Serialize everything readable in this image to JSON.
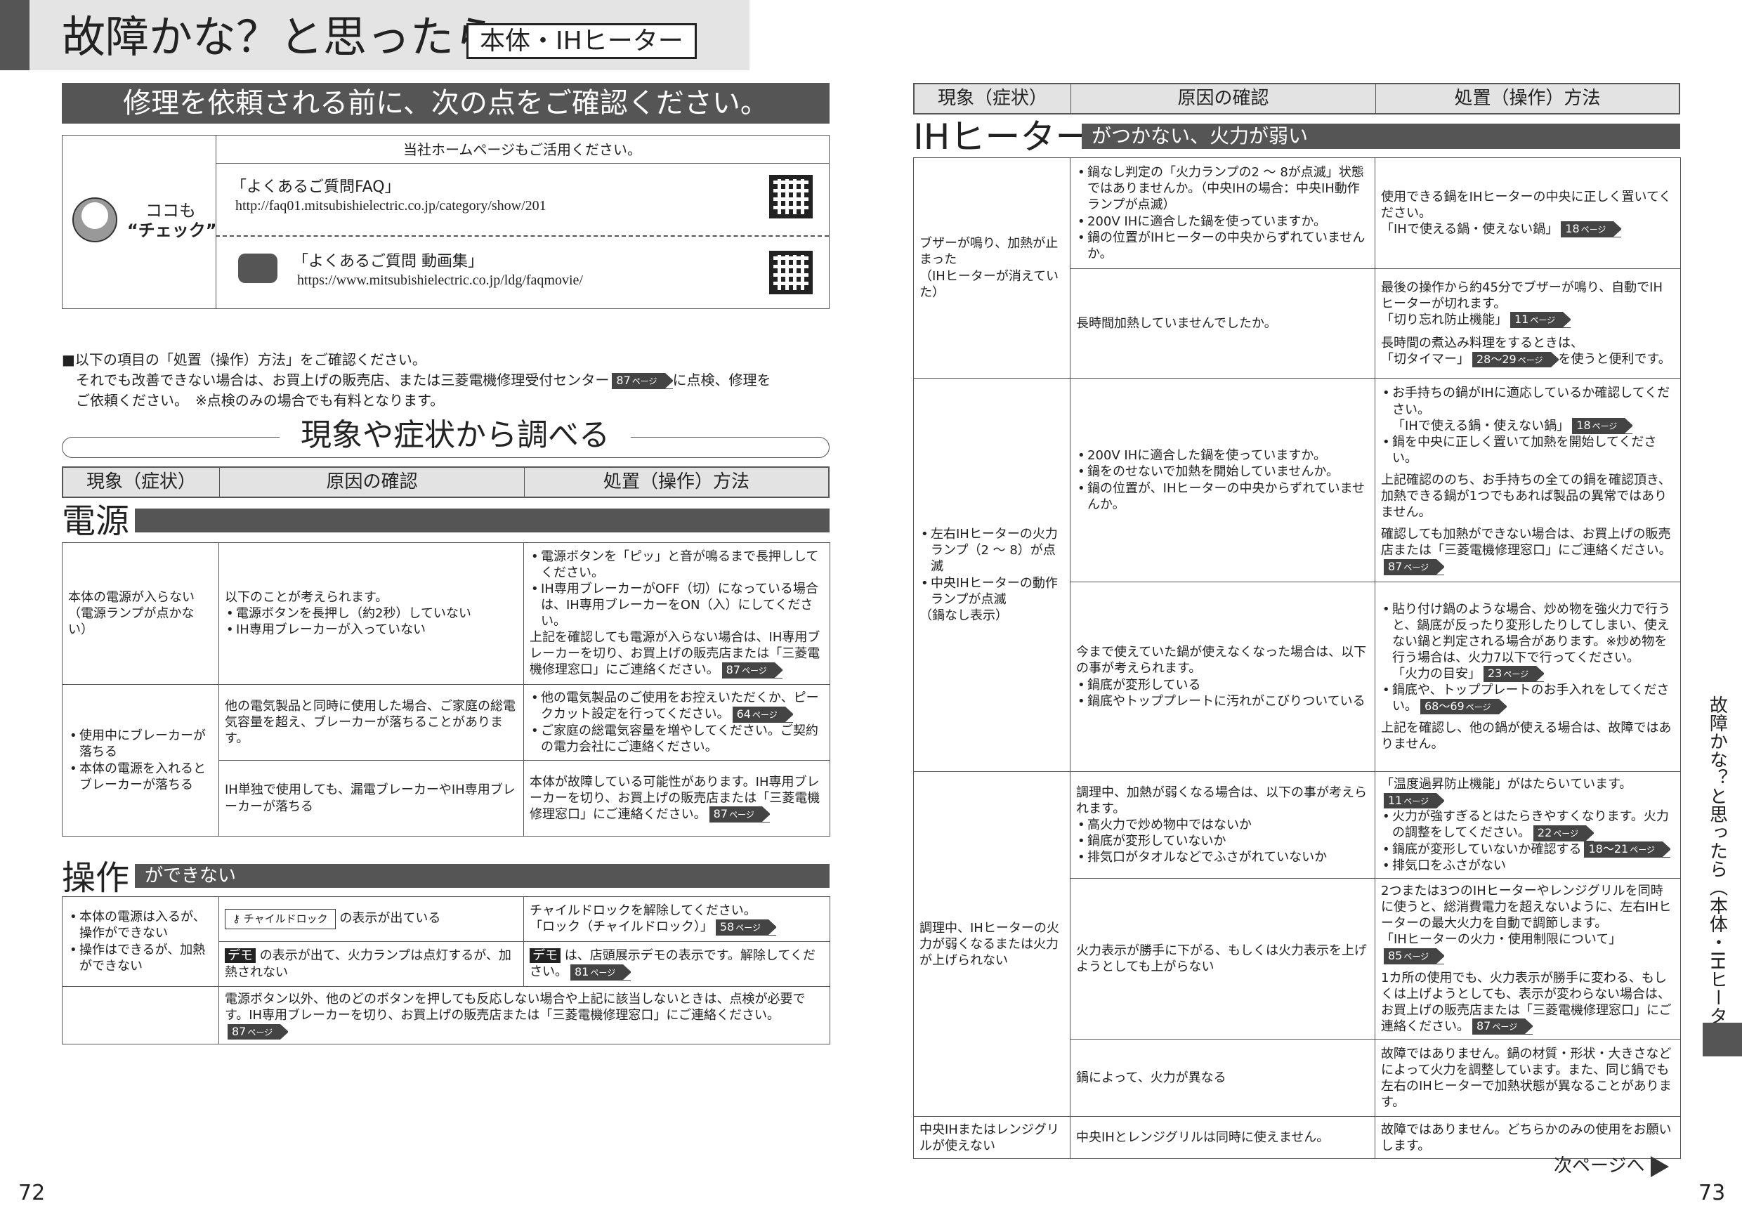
{
  "header": {
    "title": "故障かな？と思ったら",
    "tag": "本体・IHヒーター"
  },
  "left": {
    "banner": "修理を依頼される前に、次の点をご確認ください。",
    "homepage": {
      "top": "当社ホームページもご活用ください。",
      "check_a": "ココも",
      "check_b": "“チェック”",
      "faq_title": "「よくあるご質問FAQ」",
      "faq_url": "http://faq01.mitsubishielectric.co.jp/category/show/201",
      "movie_title": "「よくあるご質問 動画集」",
      "movie_url": "https://www.mitsubishielectric.co.jp/ldg/faqmovie/"
    },
    "note1": "■以下の項目の「処置（操作）方法」をご確認ください。",
    "note2a": "それでも改善できない場合は、お買上げの販売店、または三菱電機修理受付センター",
    "note2b": "に点検、修理を",
    "note3": "ご依頼ください。　※点検のみの場合でも有料となります。",
    "ref87": "87",
    "investigate": "現象や症状から調べる",
    "cols": [
      "現象（症状）",
      "原因の確認",
      "処置（操作）方法"
    ],
    "power": {
      "title": "電源",
      "r1": {
        "sym": "本体の電源が入らない\n（電源ランプが点かない）",
        "cause_intro": "以下のことが考えられます。",
        "causes": [
          "電源ボタンを長押し（約2秒）していない",
          "IH専用ブレーカーが入っていない"
        ],
        "acts": [
          "電源ボタンを「ピッ」と音が鳴るまで長押ししてください。",
          "IH専用ブレーカーがOFF（切）になっている場合は、IH専用ブレーカーをON（入）にしてください。"
        ],
        "act_tail": "上記を確認しても電源が入らない場合は、IH専用ブレーカーを切り、お買上げの販売店または「三菱電機修理窓口」にご連絡ください。",
        "ref": "87"
      },
      "r2": {
        "syms": [
          "使用中にブレーカーが落ちる",
          "本体の電源を入れるとブレーカーが落ちる"
        ],
        "c1": "他の電気製品と同時に使用した場合、ご家庭の総電気容量を超え、ブレーカーが落ちることがあります。",
        "a1": [
          "他の電気製品のご使用をお控えいただくか、ピークカット設定を行ってください。",
          "ご家庭の総電気容量を増やしてください。ご契約の電力会社にご連絡ください。"
        ],
        "a1ref": "64",
        "c2": "IH単独で使用しても、漏電ブレーカーやIH専用ブレーカーが落ちる",
        "a2": "本体が故障している可能性があります。IH専用ブレーカーを切り、お買上げの販売店または「三菱電機修理窓口」にご連絡ください。",
        "a2ref": "87"
      }
    },
    "op": {
      "title": "操作",
      "sub": "ができない",
      "syms": [
        "本体の電源は入るが、操作ができない",
        "操作はできるが、加熱ができない"
      ],
      "c1_label": "チャイルドロック",
      "c1": "の表示が出ている",
      "a1": "チャイルドロックを解除してください。",
      "a1b": "「ロック（チャイルドロック）」",
      "a1ref": "58",
      "c2_tag": "デモ",
      "c2": "の表示が出て、火力ランプは点灯するが、加熱されない",
      "a2": "は、店頭展示デモの表示です。解除してください。",
      "a2ref": "81",
      "wide": "電源ボタン以外、他のどのボタンを押しても反応しない場合や上記に該当しないときは、点検が必要です。IH専用ブレーカーを切り、お買上げの販売店または「三菱電機修理窓口」にご連絡ください。",
      "wide_ref": "87"
    },
    "page_no": "72"
  },
  "right": {
    "cols": [
      "現象（症状）",
      "原因の確認",
      "処置（操作）方法"
    ],
    "sec_title": "IHヒーター",
    "sec_sub": "がつかない、火力が弱い",
    "r1": {
      "sym": "ブザーが鳴り、加熱が止まった\n（IHヒーターが消えていた）",
      "c1": [
        "鍋なし判定の「火力ランプの2 ～ 8が点滅」状態ではありませんか。（中央IHの場合：中央IH動作ランプが点滅）",
        "200V IHに適合した鍋を使っていますか。",
        "鍋の位置がIHヒーターの中央からずれていませんか。"
      ],
      "a1": "使用できる鍋をIHヒーターの中央に正しく置いてください。",
      "a1b": "「IHで使える鍋・使えない鍋」",
      "a1ref": "18",
      "c2": "長時間加熱していませんでしたか。",
      "a2": "最後の操作から約45分でブザーが鳴り、自動でIHヒーターが切れます。",
      "a2b": "「切り忘れ防止機能」",
      "a2ref": "11",
      "a2c": "長時間の煮込み料理をするときは、",
      "a2d": "「切タイマー」",
      "a2dref": "28〜29",
      "a2e": "を使うと便利です。"
    },
    "r2": {
      "syms": [
        "左右IHヒーターの火力ランプ（2 ～ 8）が点滅",
        "中央IHヒーターの動作ランプが点滅"
      ],
      "sym_tail": "（鍋なし表示）",
      "c1": [
        "200V IHに適合した鍋を使っていますか。",
        "鍋をのせないで加熱を開始していませんか。",
        "鍋の位置が、IHヒーターの中央からずれていませんか。"
      ],
      "a1": [
        "お手持ちの鍋がIHに適応しているか確認してください。",
        "鍋を中央に正しく置いて加熱を開始してください。"
      ],
      "a1b": "「IHで使える鍋・使えない鍋」",
      "a1ref": "18",
      "a1c": "上記確認ののち、お手持ちの全ての鍋を確認頂き、加熱できる鍋が1つでもあれば製品の異常ではありません。",
      "a1d": "確認しても加熱ができない場合は、お買上げの販売店または「三菱電機修理窓口」にご連絡ください。",
      "a1dref": "87",
      "c2_intro": "今まで使えていた鍋が使えなくなった場合は、以下の事が考えられます。",
      "c2": [
        "鍋底が変形している",
        "鍋底やトッププレートに汚れがこびりついている"
      ],
      "a2": [
        "貼り付け鍋のような場合、炒め物を強火力で行うと、鍋底が反ったり変形したりしてしまい、使えない鍋と判定される場合があります。※炒め物を行う場合は、火力7以下で行ってください。",
        "鍋底や、トッププレートのお手入れをしてください。"
      ],
      "a2b": "「火力の目安」",
      "a2bref": "23",
      "a2cref": "68〜69",
      "a2d": "上記を確認し、他の鍋が使える場合は、故障ではありません。"
    },
    "r3": {
      "sym": "調理中、IHヒーターの火力が弱くなるまたは火力が上げられない",
      "c1_intro": "調理中、加熱が弱くなる場合は、以下の事が考えられます。",
      "c1": [
        "高火力で炒め物中ではないか",
        "鍋底が変形していないか",
        "排気口がタオルなどでふさがれていないか"
      ],
      "a1": "「温度過昇防止機能」がはたらいています。",
      "a1ref": "11",
      "a1l": [
        "火力が強すぎるとはたらきやすくなります。火力の調整をしてください。",
        "鍋底が変形していないか確認する",
        "排気口をふさがない"
      ],
      "a1lref1": "22",
      "a1lref2": "18〜21",
      "c2": "火力表示が勝手に下がる、もしくは火力表示を上げようとしても上がらない",
      "a2": "2つまたは3つのIHヒーターやレンジグリルを同時に使うと、総消費電力を超えないように、左右IHヒーターの最大火力を自動で調節します。",
      "a2b": "「IHヒーターの火力・使用制限について」",
      "a2ref": "85",
      "a2c": "1カ所の使用でも、火力表示が勝手に変わる、もしくは上げようとしても、表示が変わらない場合は、お買上げの販売店または「三菱電機修理窓口」にご連絡ください。",
      "a2cref": "87",
      "c3": "鍋によって、火力が異なる",
      "a3": "故障ではありません。鍋の材質・形状・大きさなどによって火力を調整しています。また、同じ鍋でも左右のIHヒーターで加熱状態が異なることがあります。"
    },
    "r4": {
      "sym": "中央IHまたはレンジグリルが使えない",
      "c": "中央IHとレンジグリルは同時に使えません。",
      "a": "故障ではありません。どちらかのみの使用をお願いします。"
    },
    "side": "故障かな？と思ったら（本体・IHヒーター）",
    "next": "次ページへ",
    "page_no": "73",
    "page_suffix": "ページ"
  }
}
